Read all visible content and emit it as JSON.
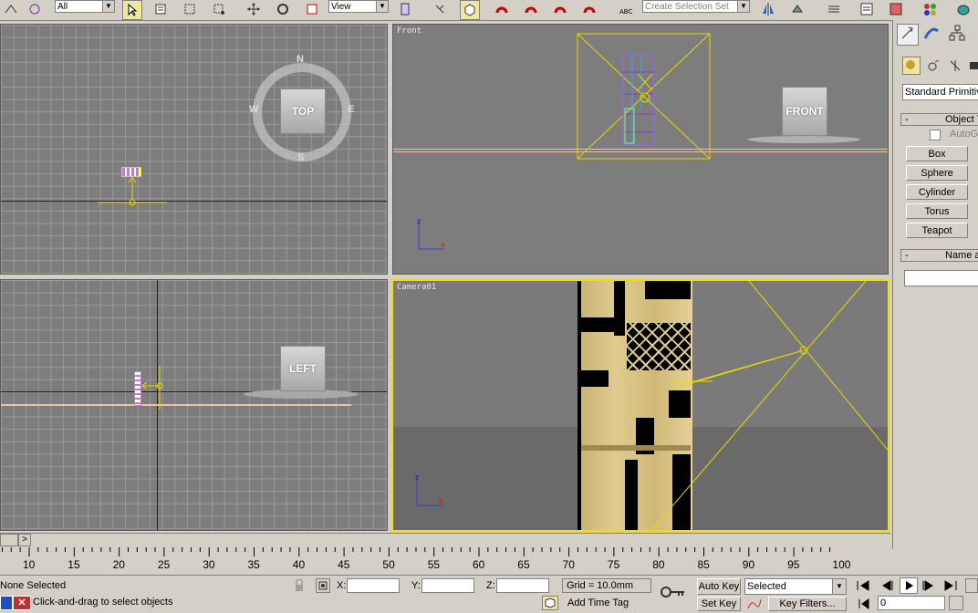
{
  "toolbar": {
    "selection_filter": "All",
    "reference_coord": "View",
    "named_selection_placeholder": "Create Selection Set"
  },
  "viewports": {
    "top": {
      "label": "",
      "cube": "TOP",
      "compass": {
        "n": "N",
        "s": "S",
        "e": "E",
        "w": "W"
      }
    },
    "front": {
      "label": "Front",
      "cube": "FRONT"
    },
    "left": {
      "label": "",
      "cube": "LEFT"
    },
    "camera": {
      "label": "Camera01"
    }
  },
  "axis": {
    "x": "x",
    "z": "z"
  },
  "command_panel": {
    "category": "Standard Primitives",
    "object_type_rollout": "Object Type",
    "autogrid": "AutoGrid",
    "primitives": [
      "Box",
      "Sphere",
      "Cylinder",
      "Torus",
      "Teapot"
    ],
    "name_rollout": "Name and Color",
    "collapse_symbol": "-"
  },
  "timeline": {
    "slider_arrow": ">",
    "ticks": [
      "10",
      "15",
      "20",
      "25",
      "30",
      "35",
      "40",
      "45",
      "50",
      "55",
      "60",
      "65",
      "70",
      "75",
      "80",
      "85",
      "90",
      "95",
      "100"
    ]
  },
  "status": {
    "selection": "None Selected",
    "prompt": "Click-and-drag to select objects",
    "x_label": "X:",
    "y_label": "Y:",
    "z_label": "Z:",
    "grid": "Grid = 10.0mm",
    "add_time_tag": "Add Time Tag",
    "auto_key": "Auto Key",
    "set_key": "Set Key",
    "key_mode": "Selected",
    "key_filters": "Key Filters...",
    "current_frame": "0"
  },
  "colors": {
    "viewport_bg": "#7d7d7d",
    "active_border": "#f0e000",
    "selection_yellow": "#e8d800",
    "wood": "#d8c080"
  }
}
